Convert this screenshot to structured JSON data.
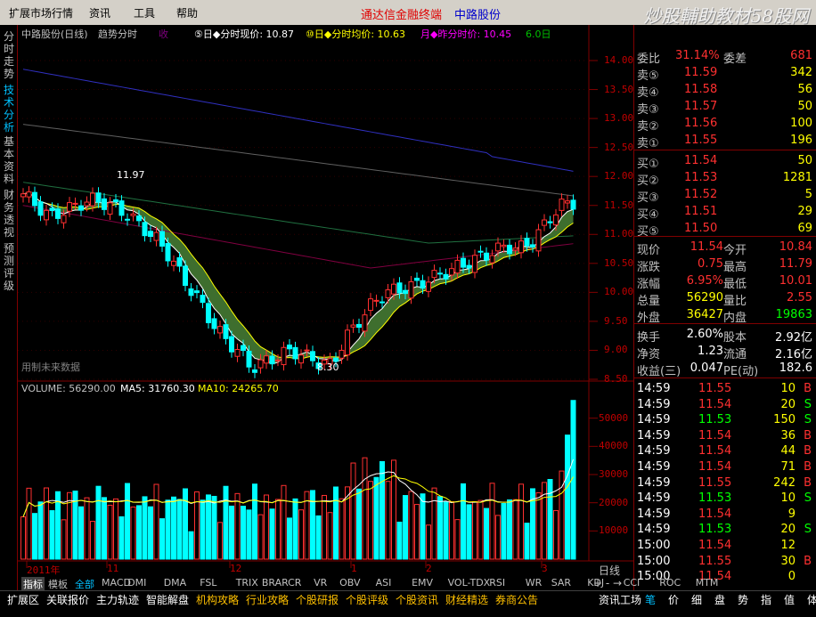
{
  "menu": {
    "items": [
      "扩展市场行情",
      "资讯",
      "工具",
      "帮助"
    ],
    "brand": "通达信金融终端",
    "stock_name": "中路股份",
    "watermark": "炒股輔助教材58股网",
    "watermark_url": "www.58Gu.com"
  },
  "sidebar": {
    "items": [
      "分时走势",
      "技术分析",
      "基本资料",
      "财务透视",
      "预测评级"
    ]
  },
  "chart_header": {
    "title": "中路股份(日线)",
    "mode": "趋势分时",
    "line1": "⑤日◆分时现价: 10.87",
    "line2": "⑩日◆分时均价: 10.63",
    "line3": "月◆昨分时价: 10.45",
    "line4": "6.0日",
    "hint": "收"
  },
  "chart_data": {
    "type": "candlestick",
    "price_axis": [
      "14.00",
      "13.50",
      "13.00",
      "12.50",
      "12.00",
      "11.50",
      "11.00",
      "10.50",
      "10.00",
      "9.50",
      "9.00",
      "8.50"
    ],
    "high_label": "11.97",
    "low_label": "8.30",
    "forecast_label": "用制未来数据",
    "volume_title": "VOLUME: 56290.00",
    "ma5_label": "MA5: 31760.30",
    "ma10_label": "MA10: 24265.70",
    "volume_axis": [
      "50000",
      "40000",
      "30000",
      "20000",
      "10000"
    ],
    "x_labels": [
      "2011年",
      "11",
      "12",
      "1",
      "2",
      "3"
    ]
  },
  "indicators": [
    "指标",
    "模板",
    "全部",
    "MACD",
    "DMI",
    "DMA",
    "FSL",
    "TRIX",
    "BRAR",
    "CR",
    "VR",
    "OBV",
    "ASI",
    "EMV",
    "VOL-TDX",
    "RSI",
    "WR",
    "SAR",
    "KDJ",
    "CCI",
    "ROC",
    "MTM"
  ],
  "period_label": "日线",
  "bottom_tabs": [
    "扩展区",
    "关联报价",
    "主力轨迹",
    "智能解盘",
    "机构攻略",
    "行业攻略",
    "个股研报",
    "个股评级",
    "个股资讯",
    "财经精选",
    "券商公告"
  ],
  "right_tabs": [
    "资讯工场",
    "笔",
    "价",
    "细",
    "盘",
    "势",
    "指",
    "值",
    "体"
  ],
  "quote": {
    "wb_label": "委比",
    "wb": "31.14%",
    "wc_label": "委差",
    "wc": "681",
    "asks": [
      {
        "label": "卖⑤",
        "price": "11.59",
        "vol": "342"
      },
      {
        "label": "卖④",
        "price": "11.58",
        "vol": "56"
      },
      {
        "label": "卖③",
        "price": "11.57",
        "vol": "50"
      },
      {
        "label": "卖②",
        "price": "11.56",
        "vol": "100"
      },
      {
        "label": "卖①",
        "price": "11.55",
        "vol": "196"
      }
    ],
    "bids": [
      {
        "label": "买①",
        "price": "11.54",
        "vol": "50"
      },
      {
        "label": "买②",
        "price": "11.53",
        "vol": "1281"
      },
      {
        "label": "买③",
        "price": "11.52",
        "vol": "5"
      },
      {
        "label": "买④",
        "price": "11.51",
        "vol": "29"
      },
      {
        "label": "买⑤",
        "price": "11.50",
        "vol": "69"
      }
    ],
    "stats": [
      {
        "l1": "现价",
        "v1": "11.54",
        "l2": "今开",
        "v2": "10.84"
      },
      {
        "l1": "涨跌",
        "v1": "0.75",
        "l2": "最高",
        "v2": "11.79"
      },
      {
        "l1": "涨幅",
        "v1": "6.95%",
        "l2": "最低",
        "v2": "10.01"
      },
      {
        "l1": "总量",
        "v1": "56290",
        "l2": "量比",
        "v2": "2.55"
      },
      {
        "l1": "外盘",
        "v1": "36427",
        "l2": "内盘",
        "v2": "19863"
      }
    ],
    "extra": [
      {
        "l1": "换手",
        "v1": "2.60%",
        "l2": "股本",
        "v2": "2.92亿"
      },
      {
        "l1": "净资",
        "v1": "1.23",
        "l2": "流通",
        "v2": "2.16亿"
      },
      {
        "l1": "收益(三)",
        "v1": "0.047",
        "l2": "PE(动)",
        "v2": "182.6"
      }
    ],
    "ticks": [
      {
        "t": "14:59",
        "p": "11.55",
        "v": "10",
        "s": "B"
      },
      {
        "t": "14:59",
        "p": "11.54",
        "v": "20",
        "s": "S"
      },
      {
        "t": "14:59",
        "p": "11.53",
        "v": "150",
        "s": "S"
      },
      {
        "t": "14:59",
        "p": "11.54",
        "v": "36",
        "s": "B"
      },
      {
        "t": "14:59",
        "p": "11.54",
        "v": "44",
        "s": "B"
      },
      {
        "t": "14:59",
        "p": "11.54",
        "v": "71",
        "s": "B"
      },
      {
        "t": "14:59",
        "p": "11.55",
        "v": "242",
        "s": "B"
      },
      {
        "t": "14:59",
        "p": "11.53",
        "v": "10",
        "s": "S"
      },
      {
        "t": "14:59",
        "p": "11.54",
        "v": "9",
        "s": ""
      },
      {
        "t": "14:59",
        "p": "11.53",
        "v": "20",
        "s": "S"
      },
      {
        "t": "15:00",
        "p": "11.54",
        "v": "12",
        "s": ""
      },
      {
        "t": "15:00",
        "p": "11.55",
        "v": "30",
        "s": "B"
      },
      {
        "t": "15:00",
        "p": "11.54",
        "v": "0",
        "s": ""
      }
    ]
  }
}
